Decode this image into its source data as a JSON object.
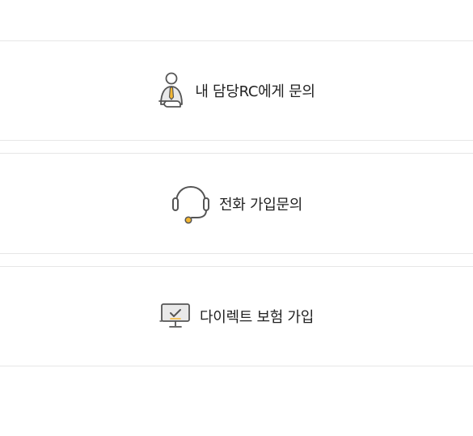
{
  "colors": {
    "text": "#222222",
    "divider": "#e6e6e6",
    "icon_stroke": "#555555",
    "icon_accent": "#f2b632"
  },
  "options": [
    {
      "id": "rc",
      "label": "내 담당RC에게 문의",
      "icon": "consultant-icon"
    },
    {
      "id": "phone",
      "label": "전화 가입문의",
      "icon": "headset-icon"
    },
    {
      "id": "direct",
      "label": "다이렉트 보험 가입",
      "icon": "monitor-check-icon"
    }
  ]
}
